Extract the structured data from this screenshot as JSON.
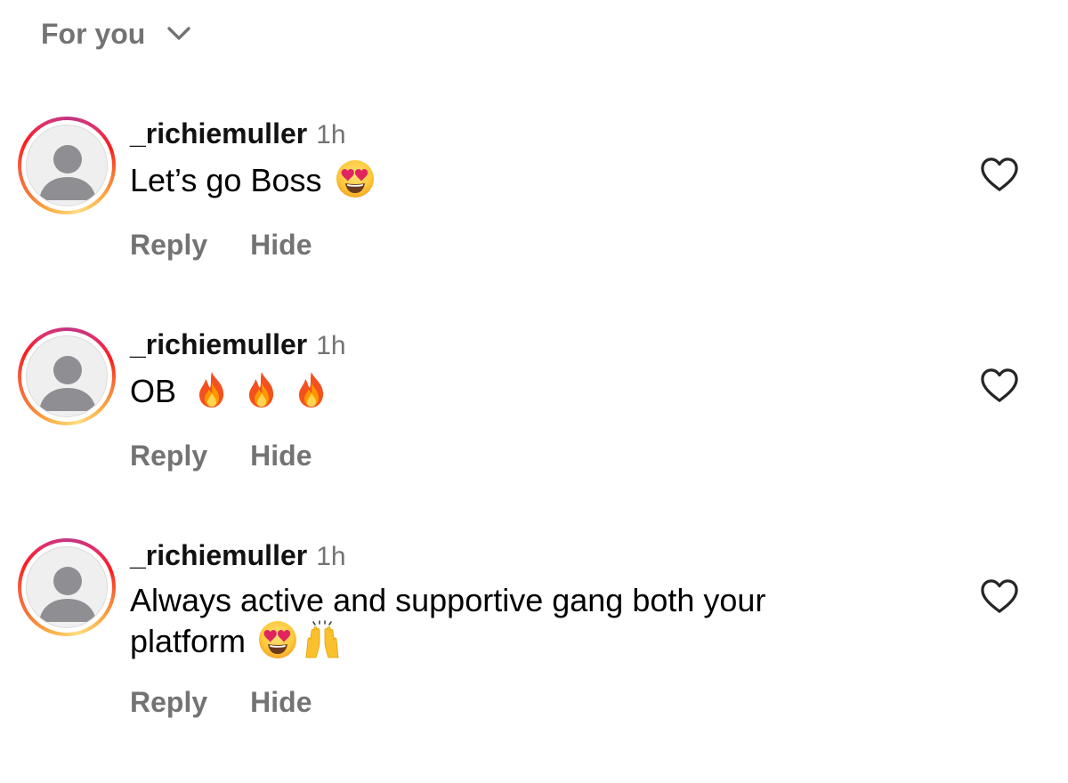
{
  "sort": {
    "label": "For you",
    "icon": "chevron-down-icon"
  },
  "colors": {
    "secondary_text": "#737373",
    "primary_text": "#000000",
    "ring_gradient": [
      "#fcaf45",
      "#f77737",
      "#fd1d1d",
      "#e1306c",
      "#c13584"
    ]
  },
  "comments": [
    {
      "username": "_richiemuller",
      "time": "1h",
      "text": "Let’s go Boss",
      "emojis": [
        "heart-eyes-emoji"
      ],
      "reply_label": "Reply",
      "hide_label": "Hide",
      "like_icon": "heart-outline-icon"
    },
    {
      "username": "_richiemuller",
      "time": "1h",
      "text": "OB",
      "emojis": [
        "fire-emoji",
        "fire-emoji",
        "fire-emoji"
      ],
      "reply_label": "Reply",
      "hide_label": "Hide",
      "like_icon": "heart-outline-icon"
    },
    {
      "username": "_richiemuller",
      "time": "1h",
      "text": "Always active and supportive gang both your platform",
      "emojis": [
        "heart-eyes-emoji",
        "raising-hands-emoji"
      ],
      "reply_label": "Reply",
      "hide_label": "Hide",
      "like_icon": "heart-outline-icon"
    }
  ]
}
